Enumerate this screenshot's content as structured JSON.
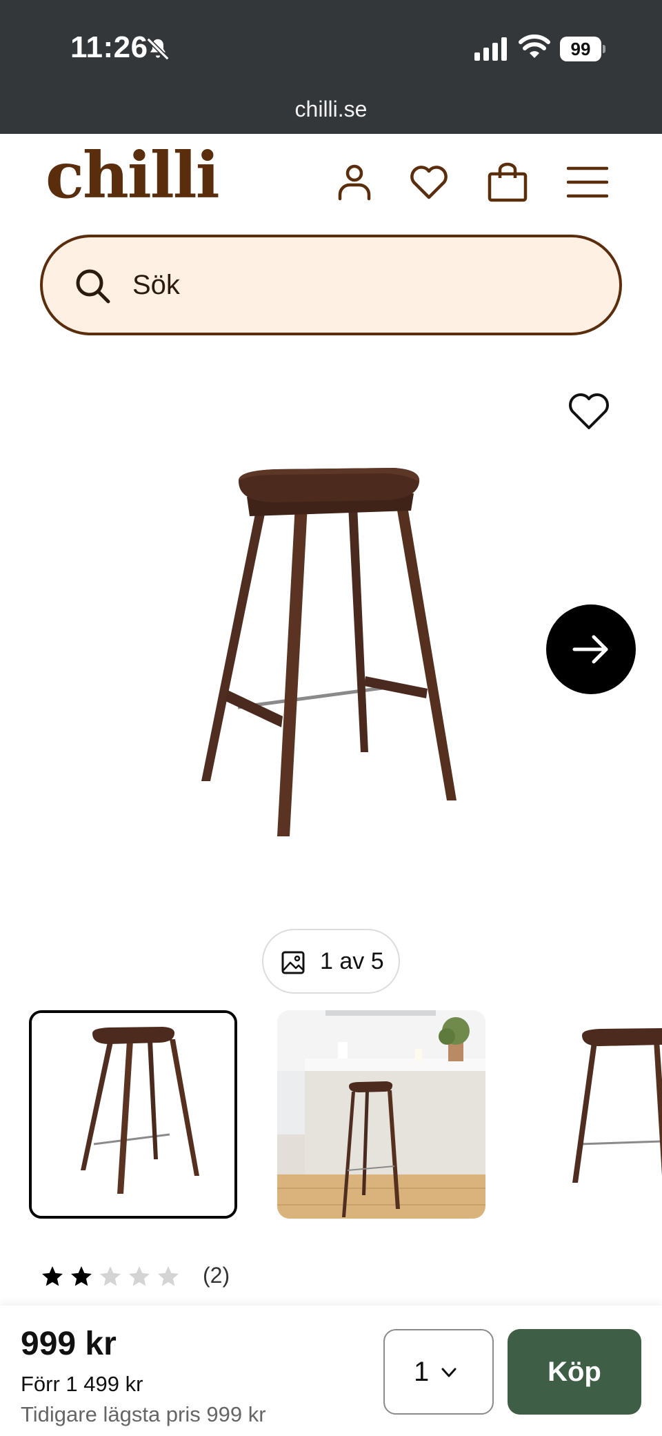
{
  "status_bar": {
    "time": "11:26",
    "battery": "99",
    "icons": [
      "bell-slash-icon",
      "signal-icon",
      "wifi-icon",
      "battery-icon"
    ]
  },
  "browser": {
    "url": "chilli.se"
  },
  "header": {
    "logo": "chilli",
    "icons": [
      "user-icon",
      "heart-icon",
      "bag-icon",
      "menu-icon"
    ]
  },
  "search": {
    "placeholder": "Sök"
  },
  "gallery": {
    "counter": "1 av 5",
    "icons": [
      "heart-icon",
      "arrow-right-icon",
      "image-icon"
    ]
  },
  "rating": {
    "stars": 2,
    "max": 5,
    "count": "(2)"
  },
  "purchase": {
    "price": "999 kr",
    "before_price": "Förr 1 499 kr",
    "lowest_price": "Tidigare lägsta pris 999 kr",
    "quantity": "1",
    "buy_label": "Köp"
  },
  "colors": {
    "brand_brown": "#5a2d0c",
    "search_bg": "#fff0e4",
    "buy_green": "#3e5f45",
    "status_bar": "#34373a"
  }
}
